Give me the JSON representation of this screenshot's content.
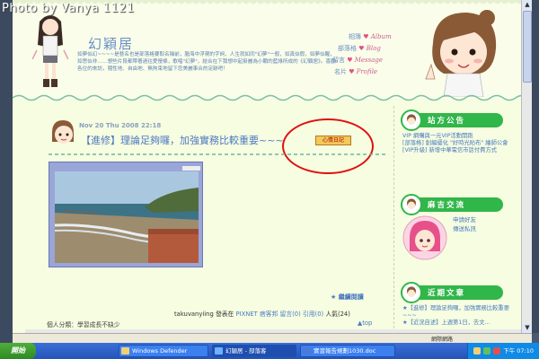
{
  "watermark": "Photo by Vanya 1121",
  "header": {
    "title": "幻穎居",
    "intro": "如夢似幻~~~~是藝名也是部落格要取名稱前，腦海中浮現的字詞，人生就如同\"幻夢\"一般，如真似假，如夢似醒，如思似非……想些片段都帶著過往愛慢條，歌唱\"幻夢\"，結合在下我想中起掛麗為小顆的藍綠所成的《幻穎居》。喜歡各位的來訪，隨性地、自由地、無拘束地留下您美麗事合的足跡吧！",
    "nav": [
      {
        "cn": "相簿",
        "en": "Album"
      },
      {
        "cn": "部落格",
        "en": "Blog"
      },
      {
        "cn": "留言",
        "en": "Message"
      },
      {
        "cn": "名片",
        "en": "Profile"
      }
    ]
  },
  "post": {
    "date": "Nov 20 Thu 2008 22:18",
    "title": "【進修】理論足夠囉，加強實務比較重要~~~",
    "tag": "心情日記",
    "continue": "★ 繼續閱讀",
    "author": "takuvanyiing",
    "posted_in": "發表在",
    "pixnet": "PIXNET",
    "collect": "痞客邦 留言(0)",
    "trackback": "引用(0)",
    "views": "人氣(24)",
    "category": "個人分類：學習成長不缺少",
    "top": "▲top"
  },
  "sidebar": {
    "announce_title": "站方公告",
    "announce_items": [
      "VIP 網購與一元VIP活動開跑",
      "[部落格] 創編優化 \"好時光貼布\" 繪師公會",
      "[VIP升級] 新增中華電信市話付費方式"
    ],
    "contact_title": "麻吉交流",
    "contact_links": [
      "申請好友",
      "傳送私訊"
    ],
    "recent_title": "近期文章",
    "recent_items": [
      "★【進修】理論足夠囉，加強實務比較重要~~~",
      "★【近況自述】上週第1日，去文..."
    ]
  },
  "statusbar": {
    "text": "網際網路"
  },
  "taskbar": {
    "start": "開始",
    "tasks": [
      "Windows Defender",
      "幻穎居 - 部落客",
      "實習報告規劃1030.doc"
    ],
    "clock": "下午 07:10"
  }
}
